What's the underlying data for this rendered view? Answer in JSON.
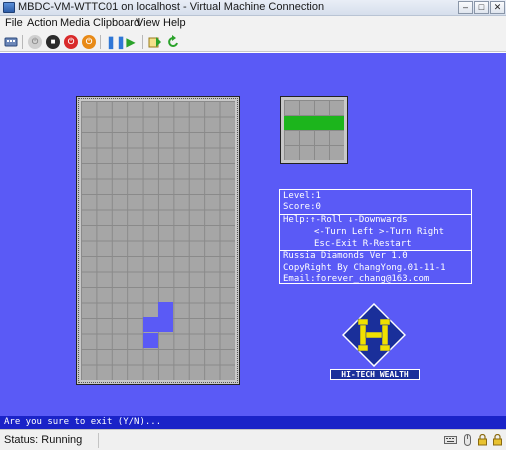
{
  "window": {
    "title": "MBDC-VM-WTTC01 on localhost - Virtual Machine Connection",
    "minimize_glyph": "–",
    "maximize_glyph": "□",
    "close_glyph": "✕"
  },
  "menu": {
    "items": [
      "File",
      "Action",
      "Media",
      "Clipboard",
      "View",
      "Help"
    ]
  },
  "toolbar": {
    "icons": [
      "ctrl-alt-del-icon",
      "start-icon",
      "turn-off-icon",
      "shut-down-icon",
      "save-icon",
      "pause-icon",
      "reset-icon",
      "snapshot-icon",
      "revert-icon"
    ]
  },
  "game": {
    "info": {
      "level": "Level:1",
      "score": "Score:0",
      "help1": "Help:↑-Roll ↓-Downwards",
      "help2": "<-Turn Left >-Turn Right",
      "help3": "Esc-Exit R-Restart",
      "about1": "Russia Diamonds Ver 1.0",
      "about2": "CopyRight By ChangYong.01-11-1",
      "about3": "Email:forever_chang@163.com"
    },
    "logo_caption": "HI-TECH WEALTH",
    "console": "Are you sure to exit (Y/N)..."
  },
  "status": {
    "text": "Status: Running"
  },
  "colors": {
    "screen_bg": "#5a5af6",
    "piece": "#5a5af6",
    "next_piece": "#1cb51c",
    "logo_yellow": "#f0e000"
  }
}
